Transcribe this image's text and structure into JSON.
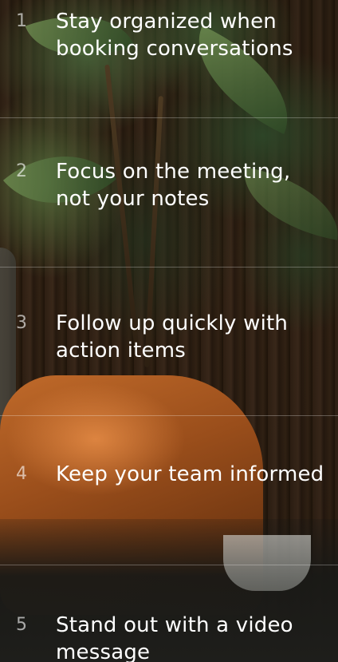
{
  "features": [
    {
      "number": "1",
      "title": "Stay organized when booking conversations"
    },
    {
      "number": "2",
      "title": "Focus on the meeting, not your notes"
    },
    {
      "number": "3",
      "title": "Follow up quickly with action items"
    },
    {
      "number": "4",
      "title": "Keep your team informed"
    },
    {
      "number": "5",
      "title": "Stand out with a video message"
    }
  ]
}
